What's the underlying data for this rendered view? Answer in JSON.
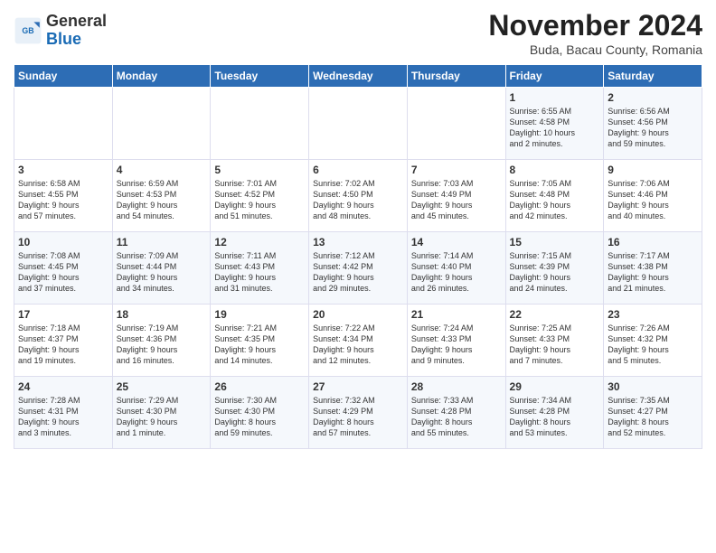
{
  "logo": {
    "line1": "General",
    "line2": "Blue"
  },
  "title": "November 2024",
  "subtitle": "Buda, Bacau County, Romania",
  "weekdays": [
    "Sunday",
    "Monday",
    "Tuesday",
    "Wednesday",
    "Thursday",
    "Friday",
    "Saturday"
  ],
  "weeks": [
    [
      {
        "day": "",
        "info": ""
      },
      {
        "day": "",
        "info": ""
      },
      {
        "day": "",
        "info": ""
      },
      {
        "day": "",
        "info": ""
      },
      {
        "day": "",
        "info": ""
      },
      {
        "day": "1",
        "info": "Sunrise: 6:55 AM\nSunset: 4:58 PM\nDaylight: 10 hours\nand 2 minutes."
      },
      {
        "day": "2",
        "info": "Sunrise: 6:56 AM\nSunset: 4:56 PM\nDaylight: 9 hours\nand 59 minutes."
      }
    ],
    [
      {
        "day": "3",
        "info": "Sunrise: 6:58 AM\nSunset: 4:55 PM\nDaylight: 9 hours\nand 57 minutes."
      },
      {
        "day": "4",
        "info": "Sunrise: 6:59 AM\nSunset: 4:53 PM\nDaylight: 9 hours\nand 54 minutes."
      },
      {
        "day": "5",
        "info": "Sunrise: 7:01 AM\nSunset: 4:52 PM\nDaylight: 9 hours\nand 51 minutes."
      },
      {
        "day": "6",
        "info": "Sunrise: 7:02 AM\nSunset: 4:50 PM\nDaylight: 9 hours\nand 48 minutes."
      },
      {
        "day": "7",
        "info": "Sunrise: 7:03 AM\nSunset: 4:49 PM\nDaylight: 9 hours\nand 45 minutes."
      },
      {
        "day": "8",
        "info": "Sunrise: 7:05 AM\nSunset: 4:48 PM\nDaylight: 9 hours\nand 42 minutes."
      },
      {
        "day": "9",
        "info": "Sunrise: 7:06 AM\nSunset: 4:46 PM\nDaylight: 9 hours\nand 40 minutes."
      }
    ],
    [
      {
        "day": "10",
        "info": "Sunrise: 7:08 AM\nSunset: 4:45 PM\nDaylight: 9 hours\nand 37 minutes."
      },
      {
        "day": "11",
        "info": "Sunrise: 7:09 AM\nSunset: 4:44 PM\nDaylight: 9 hours\nand 34 minutes."
      },
      {
        "day": "12",
        "info": "Sunrise: 7:11 AM\nSunset: 4:43 PM\nDaylight: 9 hours\nand 31 minutes."
      },
      {
        "day": "13",
        "info": "Sunrise: 7:12 AM\nSunset: 4:42 PM\nDaylight: 9 hours\nand 29 minutes."
      },
      {
        "day": "14",
        "info": "Sunrise: 7:14 AM\nSunset: 4:40 PM\nDaylight: 9 hours\nand 26 minutes."
      },
      {
        "day": "15",
        "info": "Sunrise: 7:15 AM\nSunset: 4:39 PM\nDaylight: 9 hours\nand 24 minutes."
      },
      {
        "day": "16",
        "info": "Sunrise: 7:17 AM\nSunset: 4:38 PM\nDaylight: 9 hours\nand 21 minutes."
      }
    ],
    [
      {
        "day": "17",
        "info": "Sunrise: 7:18 AM\nSunset: 4:37 PM\nDaylight: 9 hours\nand 19 minutes."
      },
      {
        "day": "18",
        "info": "Sunrise: 7:19 AM\nSunset: 4:36 PM\nDaylight: 9 hours\nand 16 minutes."
      },
      {
        "day": "19",
        "info": "Sunrise: 7:21 AM\nSunset: 4:35 PM\nDaylight: 9 hours\nand 14 minutes."
      },
      {
        "day": "20",
        "info": "Sunrise: 7:22 AM\nSunset: 4:34 PM\nDaylight: 9 hours\nand 12 minutes."
      },
      {
        "day": "21",
        "info": "Sunrise: 7:24 AM\nSunset: 4:33 PM\nDaylight: 9 hours\nand 9 minutes."
      },
      {
        "day": "22",
        "info": "Sunrise: 7:25 AM\nSunset: 4:33 PM\nDaylight: 9 hours\nand 7 minutes."
      },
      {
        "day": "23",
        "info": "Sunrise: 7:26 AM\nSunset: 4:32 PM\nDaylight: 9 hours\nand 5 minutes."
      }
    ],
    [
      {
        "day": "24",
        "info": "Sunrise: 7:28 AM\nSunset: 4:31 PM\nDaylight: 9 hours\nand 3 minutes."
      },
      {
        "day": "25",
        "info": "Sunrise: 7:29 AM\nSunset: 4:30 PM\nDaylight: 9 hours\nand 1 minute."
      },
      {
        "day": "26",
        "info": "Sunrise: 7:30 AM\nSunset: 4:30 PM\nDaylight: 8 hours\nand 59 minutes."
      },
      {
        "day": "27",
        "info": "Sunrise: 7:32 AM\nSunset: 4:29 PM\nDaylight: 8 hours\nand 57 minutes."
      },
      {
        "day": "28",
        "info": "Sunrise: 7:33 AM\nSunset: 4:28 PM\nDaylight: 8 hours\nand 55 minutes."
      },
      {
        "day": "29",
        "info": "Sunrise: 7:34 AM\nSunset: 4:28 PM\nDaylight: 8 hours\nand 53 minutes."
      },
      {
        "day": "30",
        "info": "Sunrise: 7:35 AM\nSunset: 4:27 PM\nDaylight: 8 hours\nand 52 minutes."
      }
    ]
  ]
}
